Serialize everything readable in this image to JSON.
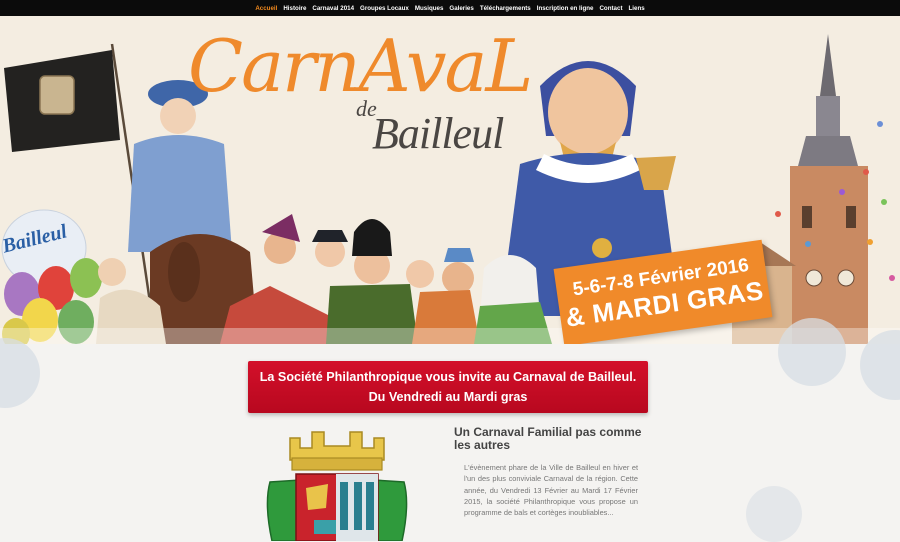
{
  "nav": {
    "items": [
      {
        "label": "Accueil",
        "active": true
      },
      {
        "label": "Histoire"
      },
      {
        "label": "Carnaval 2014"
      },
      {
        "label": "Groupes Locaux"
      },
      {
        "label": "Musiques"
      },
      {
        "label": "Galeries"
      },
      {
        "label": "Téléchargements"
      },
      {
        "label": "Inscription en ligne"
      },
      {
        "label": "Contact"
      },
      {
        "label": "Liens"
      }
    ]
  },
  "hero": {
    "title": "CarnAvaL",
    "title_de": "de",
    "title_town": "Bailleul",
    "flag_text": "Bailleul",
    "date_line1": "5-6-7-8 Février 2016",
    "date_line2": "& MARDI GRAS",
    "slides": 4,
    "active_slide": 1
  },
  "invite": {
    "text": "La Société Philanthropique vous invite au Carnaval de Bailleul. Du Vendredi au Mardi gras"
  },
  "article": {
    "title": "Un Carnaval Familial pas comme les autres",
    "body": "L'évènement phare de la Ville de Bailleul en hiver et l'un des plus conviviale Carnaval de la région. Cette année, du Vendredi 13 Février au Mardi 17 Février 2015, la société Philanthropique vous propose un programme de bals et cortèges inoubliables..."
  },
  "colors": {
    "nav_bg": "#0b0b0b",
    "nav_active": "#f28a1e",
    "accent_orange": "#f08a2a",
    "invite_red": "#c90c24",
    "heading": "#444444",
    "body_text": "#777777"
  }
}
